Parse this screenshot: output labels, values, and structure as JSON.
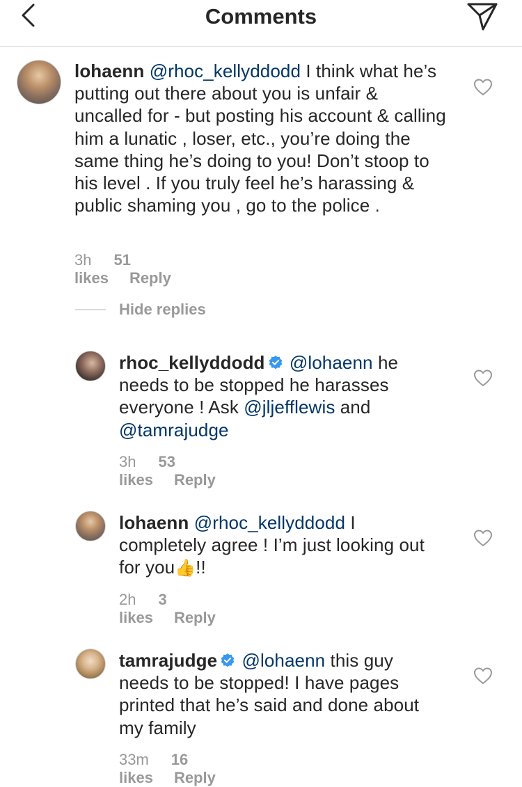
{
  "header": {
    "title": "Comments"
  },
  "comments": [
    {
      "username": "lohaenn",
      "mention": "@rhoc_kellyddodd",
      "body": "I think what he’s putting out there about you is unfair & uncalled for - but posting his account & calling him a lunatic , loser, etc., you’re doing the same thing he’s doing to you! Don’t stoop to his level .  If you truly feel he’s harassing & public shaming you , go to the police .",
      "time": "3h",
      "likes": "51 likes",
      "reply": "Reply"
    }
  ],
  "hide_replies": "Hide replies",
  "replies": [
    {
      "username": "rhoc_kellyddodd",
      "verified": true,
      "mention": "@lohaenn",
      "body_1": "he needs to be stopped he harasses everyone !  Ask",
      "mention_2": "@jljefflewis",
      "body_2": "and",
      "mention_3": "@tamrajudge",
      "time": "3h",
      "likes": "53 likes",
      "reply": "Reply"
    },
    {
      "username": "lohaenn",
      "verified": false,
      "mention": "@rhoc_kellyddodd",
      "body_1": "I completely agree ! I’m just looking out for you",
      "emoji": "👍",
      "body_2": "!!",
      "time": "2h",
      "likes": "3 likes",
      "reply": "Reply"
    },
    {
      "username": "tamrajudge",
      "verified": true,
      "mention": "@lohaenn",
      "body_1": "this guy needs to be stopped!  I have pages printed that he’s said and done about my family",
      "time": "33m",
      "likes": "16 likes",
      "reply": "Reply"
    }
  ],
  "colors": {
    "mention": "#003569",
    "meta": "#999999",
    "verified": "#3897f0",
    "text": "#262626"
  },
  "icons": {
    "back": "chevron-left-icon",
    "send": "paper-plane-icon",
    "like": "heart-outline-icon",
    "verified": "verified-badge-icon"
  }
}
